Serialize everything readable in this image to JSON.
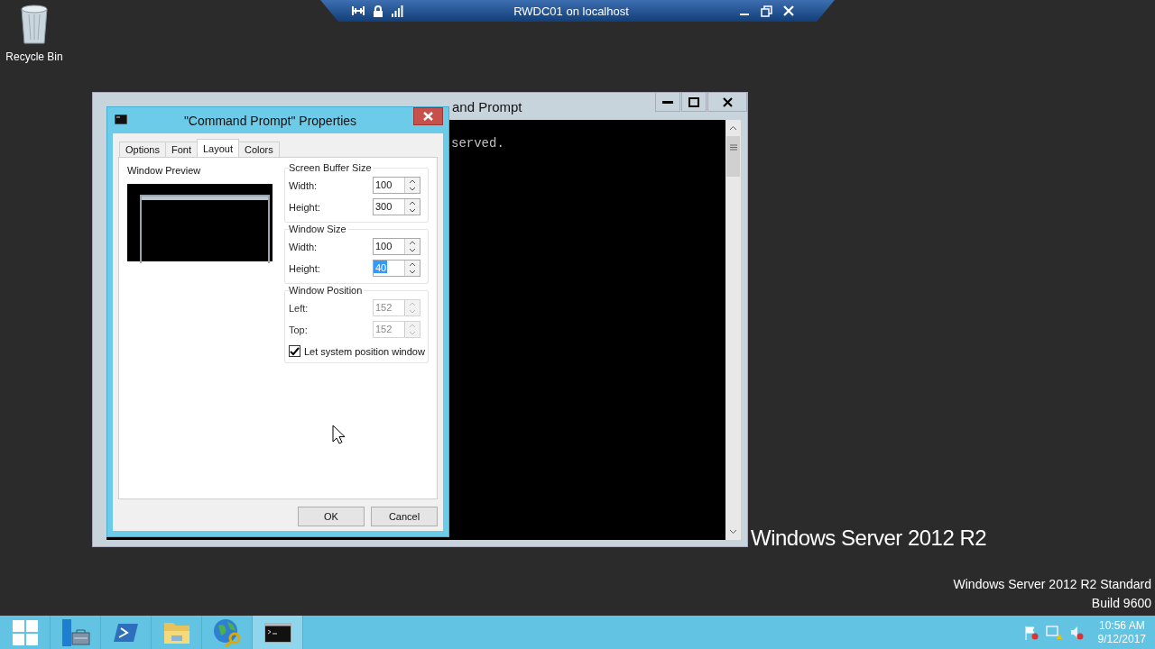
{
  "remote_bar": {
    "title": "RWDC01 on localhost"
  },
  "desktop_icons": [
    {
      "label": "Recycle Bin"
    }
  ],
  "console": {
    "title": "and Prompt",
    "lines": [
      "served."
    ]
  },
  "dialog": {
    "title": "\"Command Prompt\" Properties",
    "tabs": [
      {
        "label": "Options",
        "selected": false
      },
      {
        "label": "Font",
        "selected": false
      },
      {
        "label": "Layout",
        "selected": true
      },
      {
        "label": "Colors",
        "selected": false
      }
    ],
    "preview_label": "Window Preview",
    "groups": [
      {
        "title": "Screen Buffer Size",
        "fields": [
          {
            "label": "Width:",
            "value": "100",
            "disabled": false,
            "text_selected": false
          },
          {
            "label": "Height:",
            "value": "300",
            "disabled": false,
            "text_selected": false
          }
        ]
      },
      {
        "title": "Window Size",
        "fields": [
          {
            "label": "Width:",
            "value": "100",
            "disabled": false,
            "text_selected": false
          },
          {
            "label": "Height:",
            "value": "40",
            "disabled": false,
            "text_selected": true
          }
        ]
      },
      {
        "title": "Window Position",
        "fields": [
          {
            "label": "Left:",
            "value": "152",
            "disabled": true,
            "text_selected": false
          },
          {
            "label": "Top:",
            "value": "152",
            "disabled": true,
            "text_selected": false
          }
        ],
        "checkbox": {
          "label": "Let system position window",
          "checked": true
        }
      }
    ],
    "buttons": [
      "OK",
      "Cancel"
    ]
  },
  "branding": {
    "logo_text": "Windows Server 2012 R2",
    "edition": "Windows Server 2012 R2 Standard",
    "build": "Build 9600"
  },
  "taskbar": {
    "apps": [
      {
        "kind": "start",
        "selected": false
      },
      {
        "kind": "server-manager",
        "selected": false
      },
      {
        "kind": "powershell",
        "selected": false
      },
      {
        "kind": "explorer",
        "selected": false
      },
      {
        "kind": "globe",
        "selected": false
      },
      {
        "kind": "console",
        "selected": true
      }
    ],
    "clock": {
      "time": "10:56 AM",
      "date": "9/12/2017"
    }
  }
}
